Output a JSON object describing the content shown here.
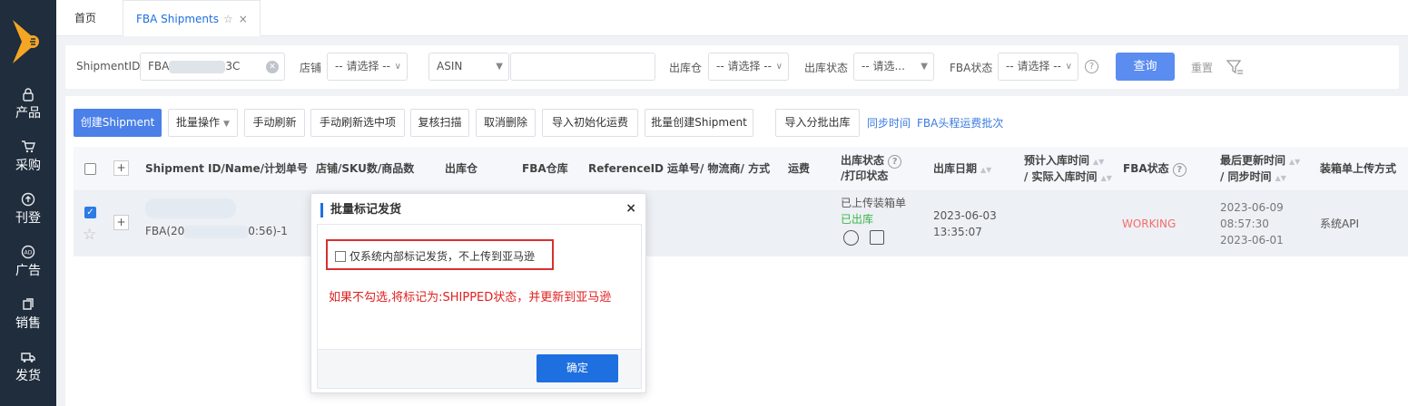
{
  "sidebar": {
    "items": [
      {
        "icon": "lock-icon",
        "label": "产品"
      },
      {
        "icon": "cart-icon",
        "label": "采购"
      },
      {
        "icon": "upload-icon",
        "label": "刊登"
      },
      {
        "icon": "ad-icon",
        "label": "广告"
      },
      {
        "icon": "sales-icon",
        "label": "销售"
      },
      {
        "icon": "truck-icon",
        "label": "发货"
      }
    ]
  },
  "tabs": {
    "home": "首页",
    "active": "FBA Shipments"
  },
  "filters": {
    "shipment_label": "ShipmentID",
    "shipment_value_prefix": "FBA",
    "shipment_value_suffix": "3C",
    "store_label": "店铺",
    "placeholder": "-- 请选择 --",
    "placeholder_short": "-- 请选...",
    "asin_select": "ASIN",
    "warehouse_label": "出库仓",
    "outbound_status_label": "出库状态",
    "fba_status_label": "FBA状态",
    "query_button": "查询",
    "reset_button": "重置"
  },
  "toolbar": {
    "create": "创建Shipment",
    "batch_ops": "批量操作",
    "manual_refresh": "手动刷新",
    "refresh_selected": "手动刷新选中项",
    "recheck_scan": "复核扫描",
    "cancel_delete": "取消删除",
    "import_freight": "导入初始化运费",
    "batch_create": "批量创建Shipment",
    "import_batch_out": "导入分批出库",
    "sync_time": "同步时间",
    "fba_freight_batch": "FBA头程运费批次"
  },
  "table": {
    "headers": {
      "shipment": "Shipment ID/Name/计划单号",
      "store_sku": "店铺/SKU数/商品数",
      "warehouse": "出库仓",
      "fba_wh": "FBA仓库",
      "ref": "ReferenceID",
      "tracking": "运单号/ 物流商/ 方式",
      "freight": "运费",
      "out_status_1": "出库状态",
      "out_status_2": "/打印状态",
      "out_date": "出库日期",
      "eta_1": "预计入库时间",
      "eta_2": "/ 实际入库时间",
      "fba_status": "FBA状态",
      "updated_1": "最后更新时间",
      "updated_2": "/ 同步时间",
      "upload_method": "装箱单上传方式"
    },
    "row": {
      "name": "FBA(20",
      "name_suffix": "0:56)-1",
      "box_status": "已上传装箱单",
      "out_status": "已出库",
      "out_date": "2023-06-03",
      "out_time": "13:35:07",
      "fba_status": "WORKING",
      "updated_date": "2023-06-09",
      "updated_time": "08:57:30",
      "sync_date": "2023-06-01",
      "upload_method": "系统API"
    }
  },
  "modal": {
    "title": "批量标记发货",
    "checkbox_label": "仅系统内部标记发货，不上传到亚马逊",
    "warning": "如果不勾选,将标记为:SHIPPED状态，并更新到亚马逊",
    "ok_button": "确定"
  },
  "colors": {
    "primary": "#1e6fe0",
    "sidebar": "#1f2d3d",
    "warning": "#e02020",
    "status_green": "#3bb54a",
    "status_red": "#f56c6c"
  }
}
